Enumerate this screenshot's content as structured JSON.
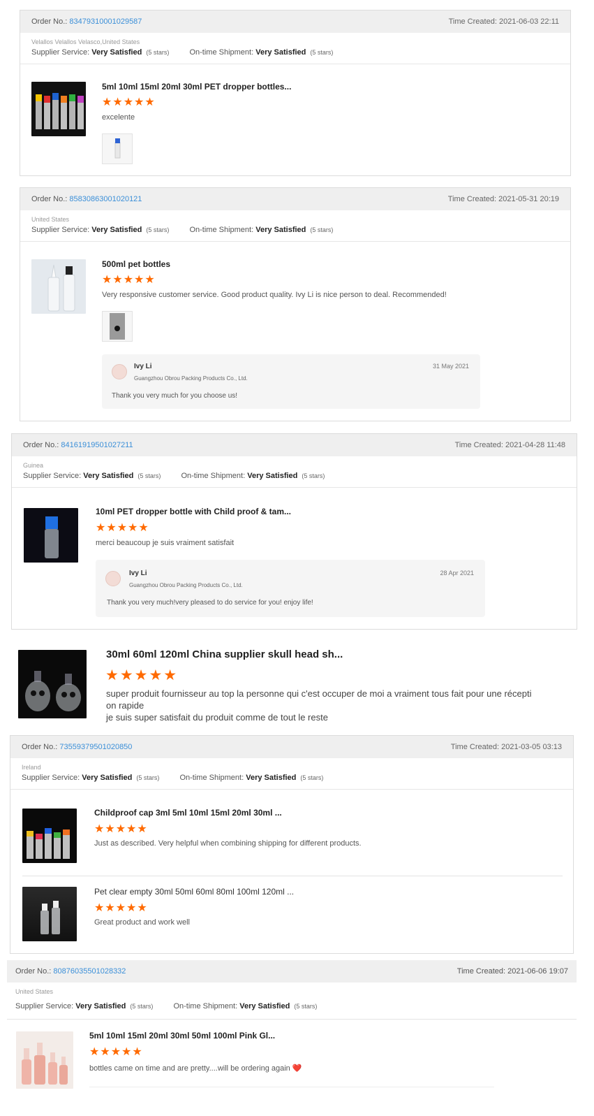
{
  "reviews": [
    {
      "order_label": "Order No.:",
      "order_no": "83479310001029587",
      "time_label": "Time Created:",
      "time": "2021-06-03 22:11",
      "buyer": "Velallos Velallos Velasco,United States",
      "supplier_label": "Supplier Service:",
      "supplier_value": "Very Satisfied",
      "supplier_stars": "(5 stars)",
      "shipment_label": "On-time Shipment:",
      "shipment_value": "Very Satisfied",
      "shipment_stars": "(5 stars)",
      "items": [
        {
          "title": "5ml 10ml 15ml 20ml 30ml PET dropper bottles...",
          "stars": "★★★★★",
          "comment": "excelente"
        }
      ]
    },
    {
      "order_label": "Order No.:",
      "order_no": "85830863001020121",
      "time_label": "Time Created:",
      "time": "2021-05-31 20:19",
      "buyer": "United States",
      "supplier_label": "Supplier Service:",
      "supplier_value": "Very Satisfied",
      "supplier_stars": "(5 stars)",
      "shipment_label": "On-time Shipment:",
      "shipment_value": "Very Satisfied",
      "shipment_stars": "(5 stars)",
      "items": [
        {
          "title": "500ml pet bottles",
          "stars": "★★★★★",
          "comment": "Very responsive customer service. Good product quality. Ivy Li is nice person to deal. Recommended!"
        }
      ],
      "reply": {
        "name": "Ivy Li",
        "company": "Guangzhou Obrou Packing Products Co., Ltd.",
        "date": "31 May 2021",
        "text": "Thank you very much for you choose us!"
      }
    },
    {
      "order_label": "Order No.:",
      "order_no": "84161919501027211",
      "time_label": "Time Created:",
      "time": "2021-04-28 11:48",
      "buyer": "Guinea",
      "supplier_label": "Supplier Service:",
      "supplier_value": "Very Satisfied",
      "supplier_stars": "(5 stars)",
      "shipment_label": "On-time Shipment:",
      "shipment_value": "Very Satisfied",
      "shipment_stars": "(5 stars)",
      "items": [
        {
          "title": "10ml PET dropper bottle with Child proof & tam...",
          "stars": "★★★★★",
          "comment": "merci beaucoup je suis vraiment satisfait"
        }
      ],
      "reply": {
        "name": "Ivy Li",
        "company": "Guangzhou Obrou Packing Products Co., Ltd.",
        "date": "28 Apr 2021",
        "text": "Thank you very much!very pleased to do service for  you! enjoy life!"
      }
    },
    {
      "order_label": "Order No.:",
      "order_no": "73559379501020850",
      "time_label": "Time Created:",
      "time": "2021-03-05 03:13",
      "buyer": "Ireland",
      "supplier_label": "Supplier Service:",
      "supplier_value": "Very Satisfied",
      "supplier_stars": "(5 stars)",
      "shipment_label": "On-time Shipment:",
      "shipment_value": "Very Satisfied",
      "shipment_stars": "(5 stars)",
      "items": [
        {
          "title": "Childproof cap 3ml 5ml 10ml 15ml 20ml 30ml ...",
          "stars": "★★★★★",
          "comment": "Just as described. Very helpful when combining shipping for different products."
        },
        {
          "title": "Pet clear empty 30ml 50ml 60ml 80ml 100ml 120ml ...",
          "stars": "★★★★★",
          "comment": "Great product and work well"
        }
      ]
    },
    {
      "order_label": "Order No.:",
      "order_no": "80876035501028332",
      "time_label": "Time Created:",
      "time": "2021-06-06 19:07",
      "buyer": "United States",
      "supplier_label": "Supplier Service:",
      "supplier_value": "Very Satisfied",
      "supplier_stars": "(5 stars)",
      "shipment_label": "On-time Shipment:",
      "shipment_value": "Very Satisfied",
      "shipment_stars": "(5 stars)",
      "items": [
        {
          "title": "5ml 10ml 15ml 20ml 30ml 50ml 100ml Pink Gl...",
          "stars": "★★★★★",
          "comment": "bottles came on time and are pretty....will be ordering again ❤️"
        }
      ]
    }
  ],
  "standalone": {
    "title": "30ml 60ml 120ml China supplier skull head sh...",
    "stars": "★★★★★",
    "comment_line1": "super produit fournisseur au top la personne qui c'est occuper de moi a vraiment tous fait pour une récepti",
    "comment_line2": "on rapide",
    "comment_line3": "je suis super satisfait du produit comme de tout le reste"
  }
}
